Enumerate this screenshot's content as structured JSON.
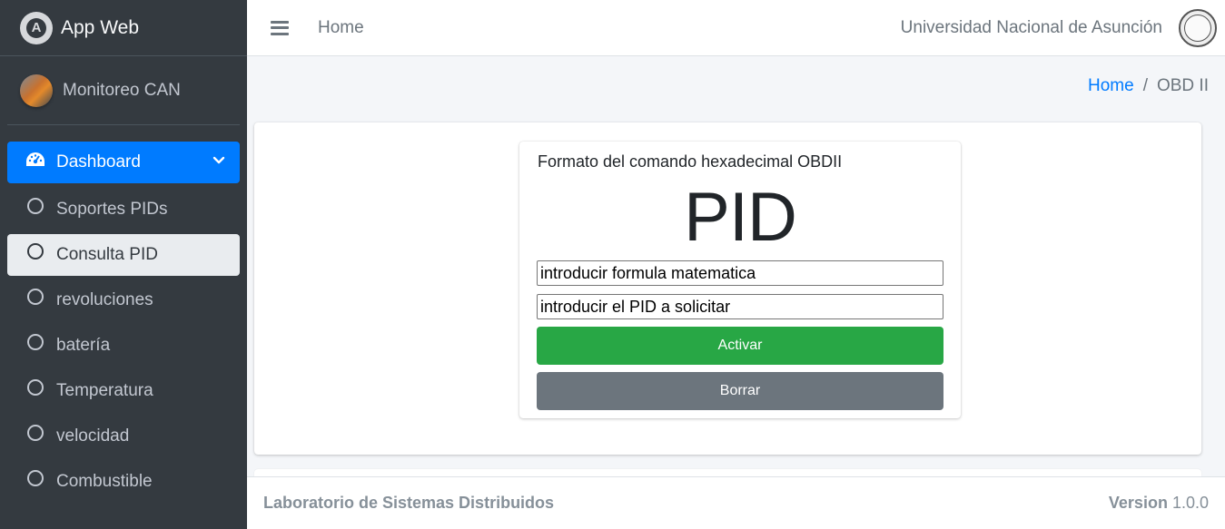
{
  "brand": {
    "title": "App Web"
  },
  "user": {
    "name": "Monitoreo CAN"
  },
  "sidebar": {
    "dashboard_label": "Dashboard",
    "items": [
      {
        "label": "Soportes PIDs"
      },
      {
        "label": "Consulta PID"
      },
      {
        "label": "revoluciones"
      },
      {
        "label": "batería"
      },
      {
        "label": "Temperatura"
      },
      {
        "label": "velocidad"
      },
      {
        "label": "Combustible"
      }
    ]
  },
  "topbar": {
    "home_link": "Home",
    "university": "Universidad Nacional de Asunción"
  },
  "breadcrumb": {
    "home": "Home",
    "separator": "/",
    "current": "OBD II"
  },
  "pid_card": {
    "title": "Formato del comando hexadecimal OBDII",
    "display": "PID",
    "formula_input": "introducir formula matematica",
    "pid_input": "introducir el PID a solicitar",
    "activate_label": "Activar",
    "clear_label": "Borrar"
  },
  "footer": {
    "lab": "Laboratorio de Sistemas Distribuidos",
    "version_label": "Version",
    "version_number": "1.0.0"
  },
  "colors": {
    "sidebar_bg": "#343a40",
    "primary": "#007bff",
    "success": "#28a745",
    "secondary": "#6c757d"
  }
}
